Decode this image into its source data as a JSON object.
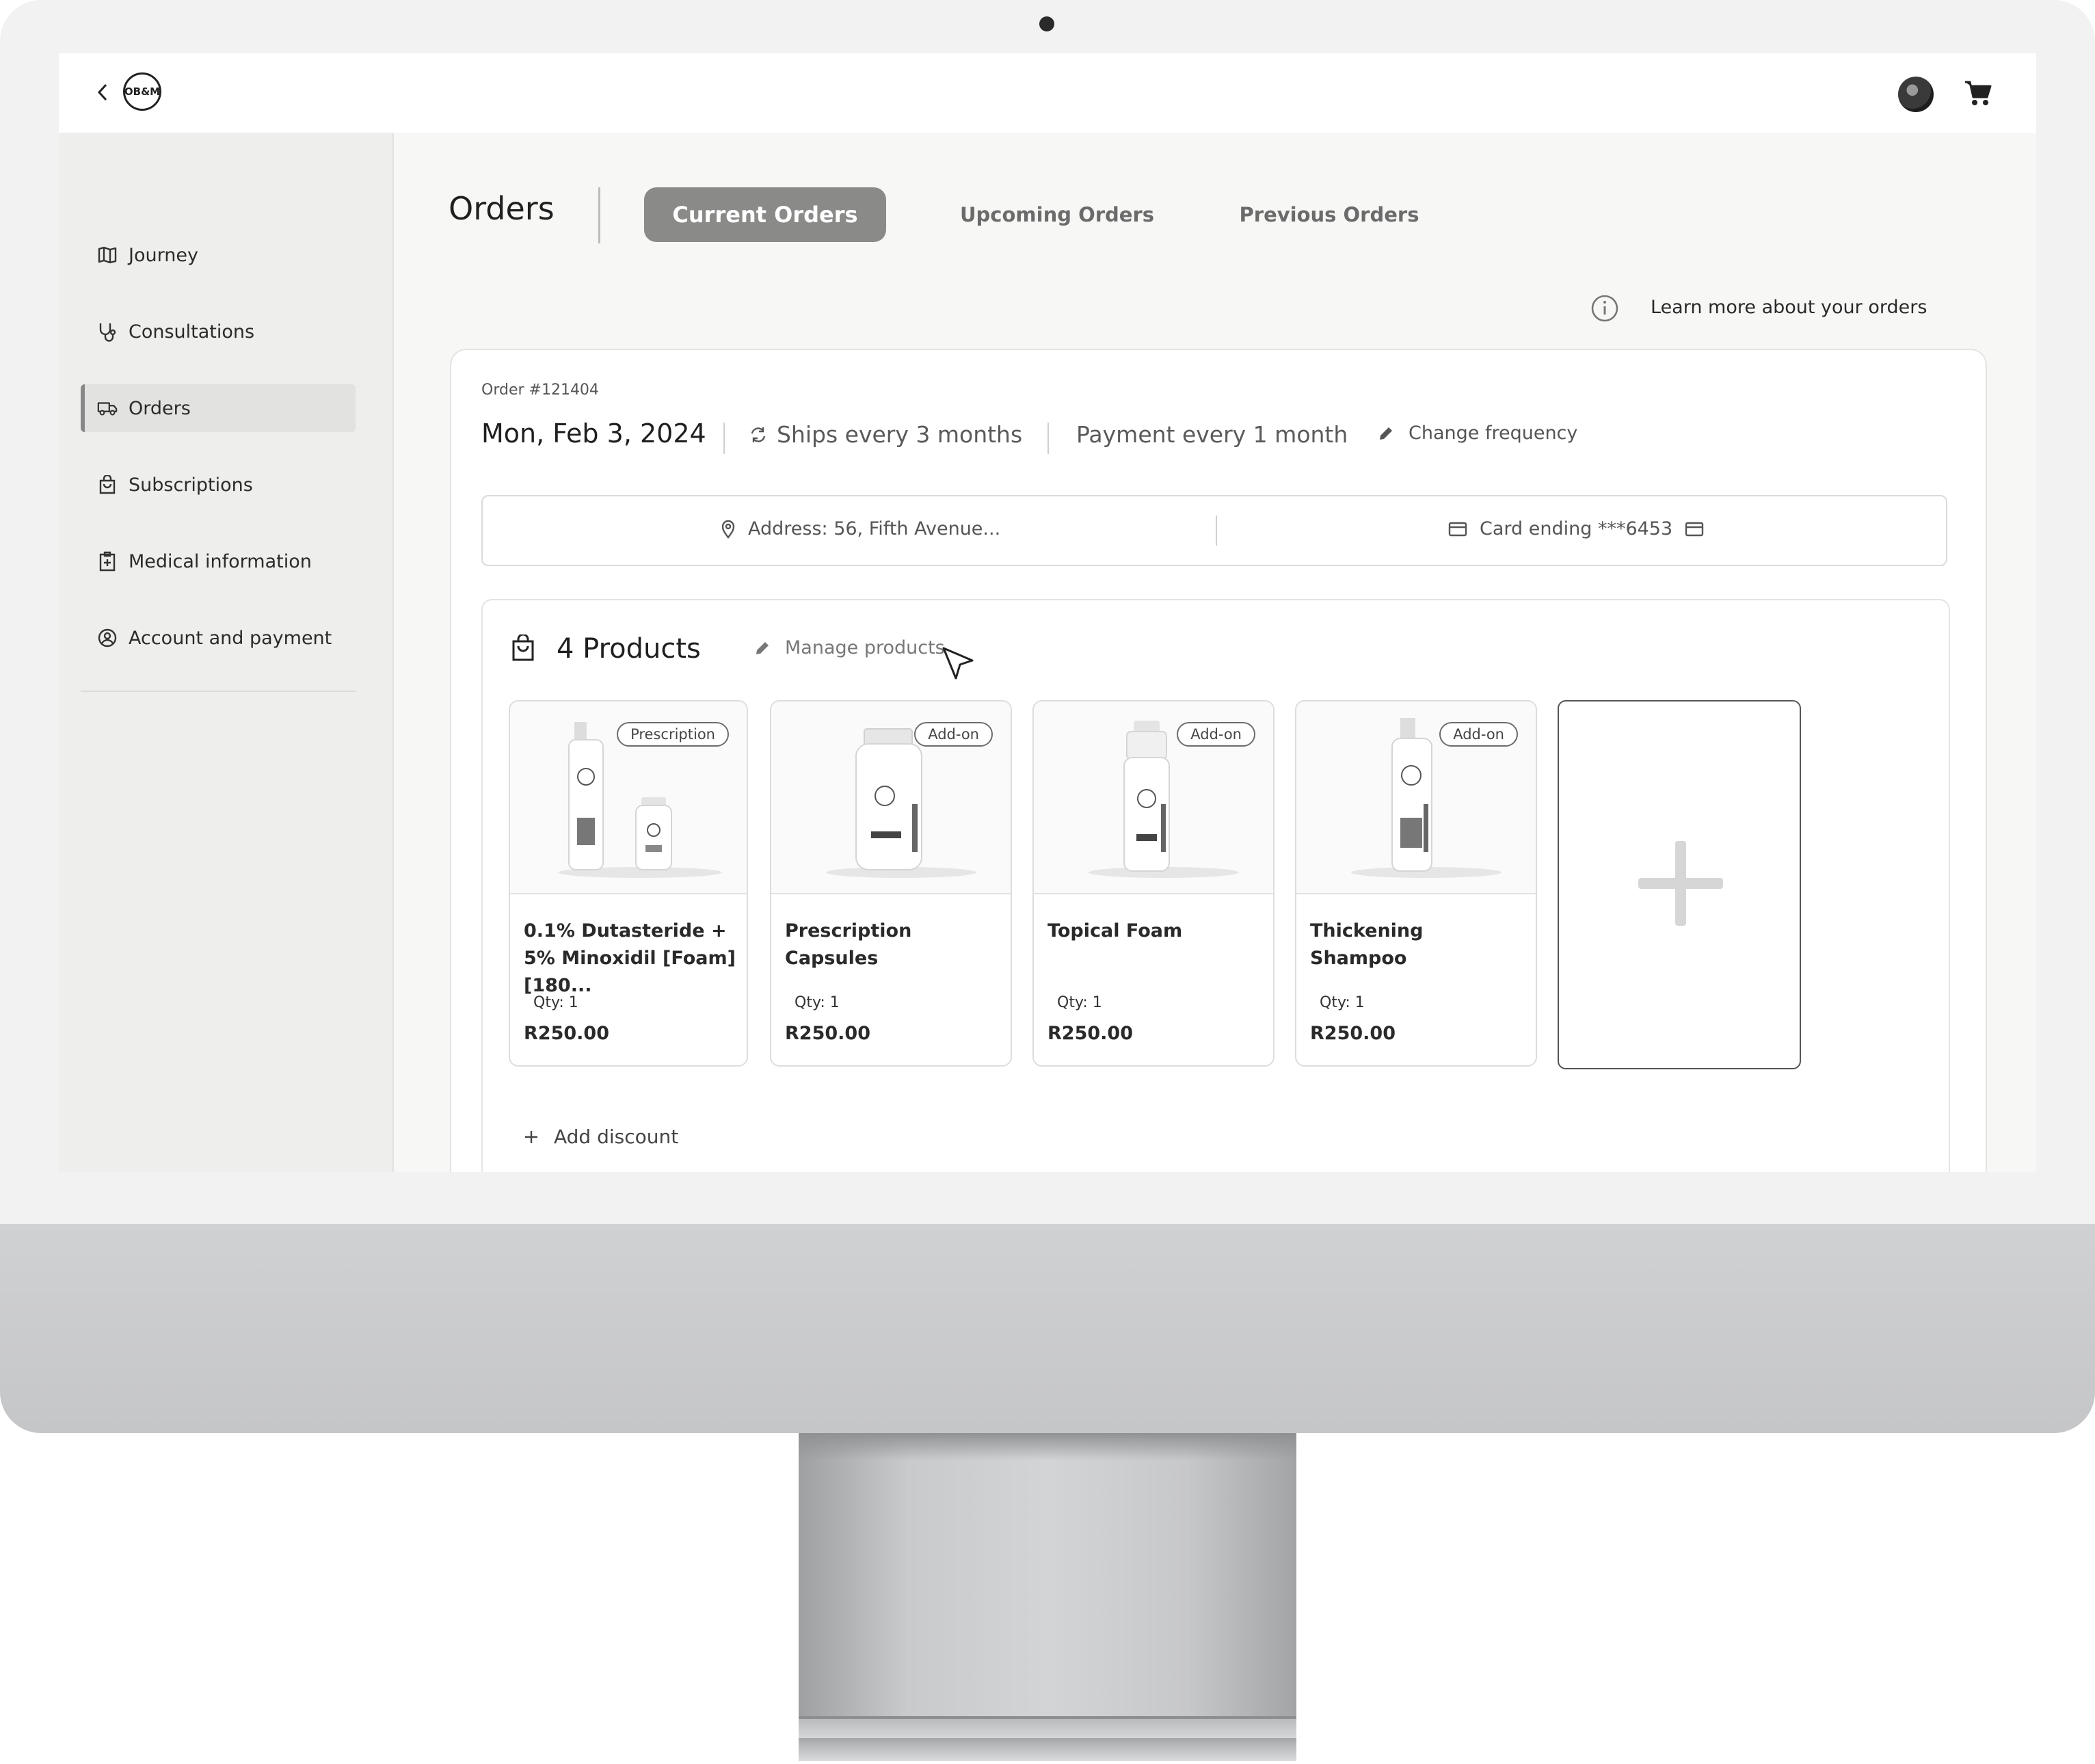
{
  "header": {
    "logo_text": "OB&M"
  },
  "sidebar": {
    "items": [
      {
        "label": "Journey",
        "icon": "map-icon"
      },
      {
        "label": "Consultations",
        "icon": "stethoscope-icon"
      },
      {
        "label": "Orders",
        "icon": "truck-icon",
        "active": true
      },
      {
        "label": "Subscriptions",
        "icon": "bag-icon"
      },
      {
        "label": "Medical information",
        "icon": "medical-clipboard-icon"
      },
      {
        "label": "Account and payment",
        "icon": "user-circle-icon"
      }
    ]
  },
  "page": {
    "title": "Orders",
    "tabs": [
      {
        "label": "Current Orders",
        "active": true
      },
      {
        "label": "Upcoming Orders",
        "active": false
      },
      {
        "label": "Previous Orders",
        "active": false
      }
    ],
    "learn_more": "Learn more about your orders"
  },
  "order": {
    "number": "Order #121404",
    "date": "Mon, Feb 3, 2024",
    "ships": "Ships every 3 months",
    "payment": "Payment every 1 month",
    "change_frequency": "Change frequency",
    "address": "Address: 56, Fifth Avenue...",
    "card": "Card ending ***6453"
  },
  "products": {
    "count_label": "4 Products",
    "manage_label": "Manage products",
    "items": [
      {
        "badge": "Prescription",
        "name": "0.1% Dutasteride + 5% Minoxidil [Foam][180...",
        "qty": "Qty: 1",
        "price": "R250.00",
        "image": "bottle-and-capsule-jar"
      },
      {
        "badge": "Add-on",
        "name": "Prescription Capsules",
        "qty": "Qty: 1",
        "price": "R250.00",
        "image": "capsule-jar"
      },
      {
        "badge": "Add-on",
        "name": "Topical Foam",
        "qty": "Qty: 1",
        "price": "R250.00",
        "image": "foam-pump-bottle"
      },
      {
        "badge": "Add-on",
        "name": "Thickening Shampoo",
        "qty": "Qty: 1",
        "price": "R250.00",
        "image": "shampoo-bottle"
      }
    ],
    "add_discount": "Add discount"
  },
  "colors": {
    "active_tab": "#8a8a89",
    "sidebar_bg": "#eeeeec",
    "screen_bg": "#f7f7f6",
    "chin": "#c8c9cb"
  }
}
